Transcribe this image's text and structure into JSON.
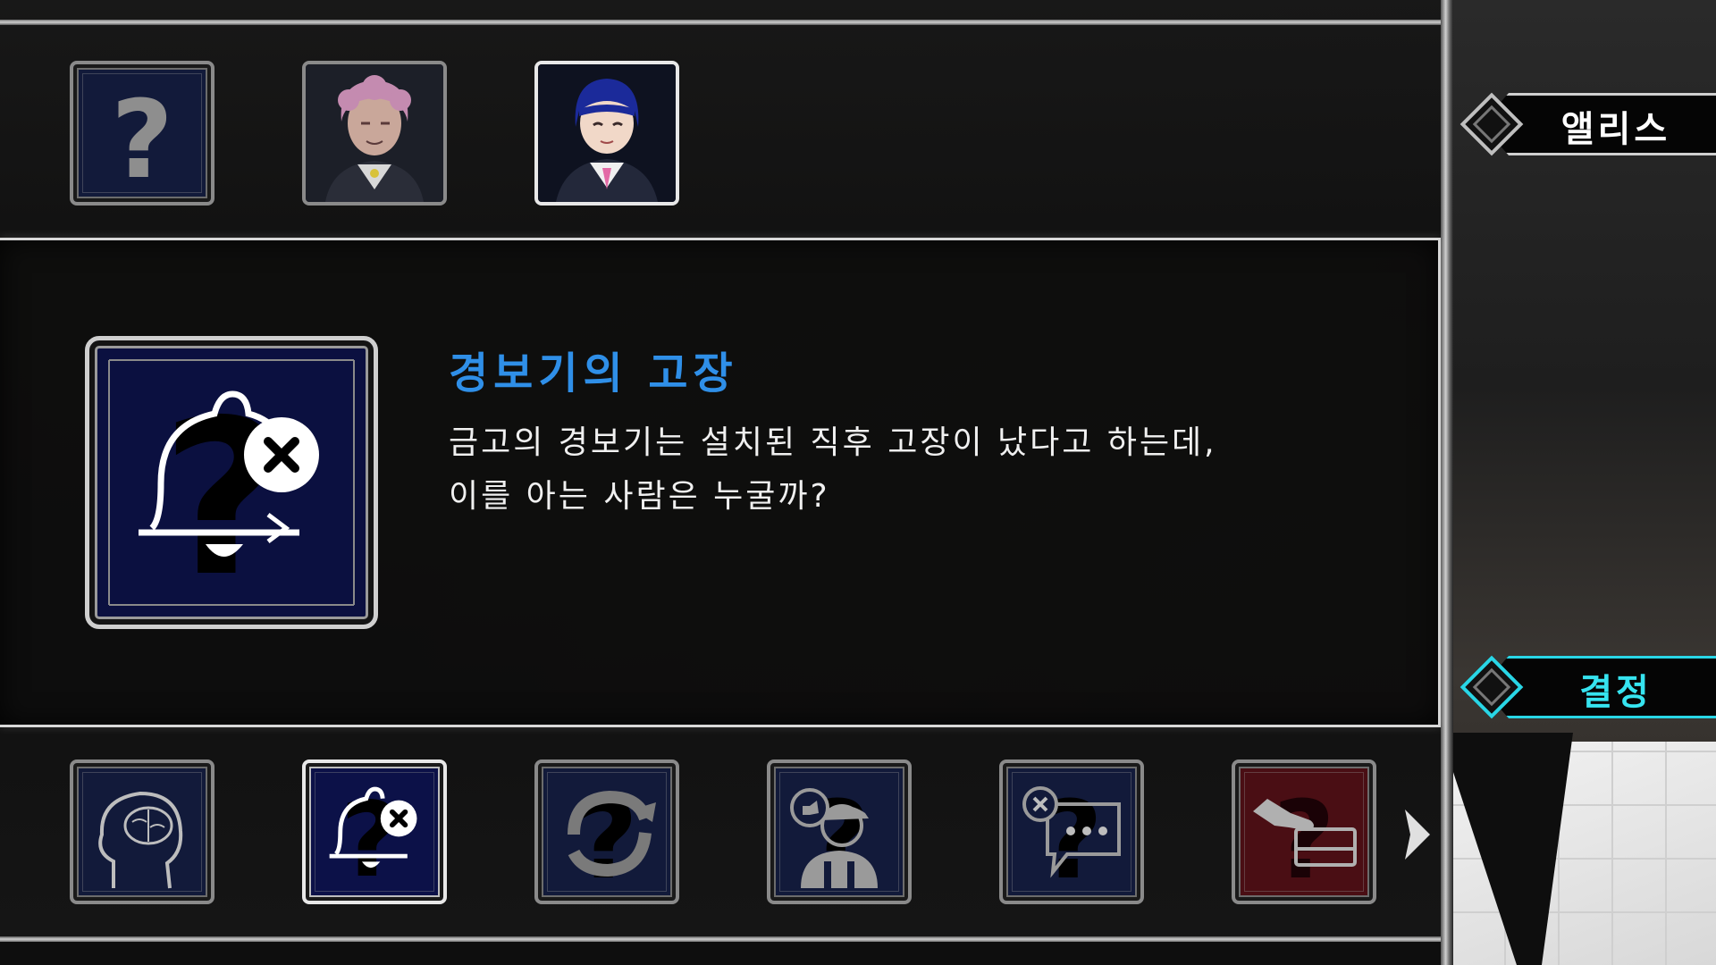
{
  "suspects": [
    {
      "name": "unknown-suspect",
      "glyph": "?"
    },
    {
      "name": "pink-hair-student"
    },
    {
      "name": "blue-hair-student"
    }
  ],
  "clue": {
    "title": "경보기의 고장",
    "description_line1": "금고의 경보기는 설치된 직후 고장이 났다고 하는데,",
    "description_line2": "이를 아는 사람은 누굴까?",
    "icon": "broken-alarm-bell-icon"
  },
  "clue_tiles": [
    {
      "icon": "brain-head-icon"
    },
    {
      "icon": "broken-alarm-bell-icon",
      "selected": true
    },
    {
      "icon": "rotate-arrow-icon"
    },
    {
      "icon": "worker-thumbs-down-icon"
    },
    {
      "icon": "cancelled-chat-icon"
    },
    {
      "icon": "hand-card-icon",
      "color": "#4a0e14"
    }
  ],
  "side": {
    "character_name": "앨리스",
    "decide_label": "결정"
  },
  "colors": {
    "title_blue": "#2f8fe8",
    "decide_cyan": "#36e4f0"
  }
}
